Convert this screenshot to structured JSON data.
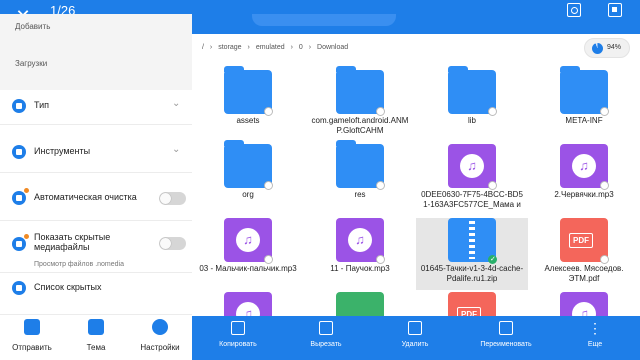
{
  "header": {
    "counter": "1/26",
    "close_icon": "close-icon",
    "accent": "#1e7ee8"
  },
  "drawer": {
    "top_items": [
      {
        "label": "Добавить"
      },
      {
        "label": "Загрузки"
      }
    ],
    "rows": [
      {
        "label": "Тип",
        "icon": "type-icon",
        "control": "chevron"
      },
      {
        "label": "Инструменты",
        "icon": "tools-icon",
        "control": "chevron"
      },
      {
        "label": "Автоматическая очистка",
        "icon": "clean-icon",
        "control": "toggle",
        "toggle_on": false
      },
      {
        "label": "Показать скрытые медиафайлы",
        "sublabel": "Просмотр файлов .nomedia",
        "icon": "hidden-media-icon",
        "control": "toggle",
        "toggle_on": false
      },
      {
        "label": "Список скрытых",
        "icon": "hidden-list-icon",
        "control": "none"
      }
    ],
    "bottom": [
      {
        "label": "Отправить",
        "icon": "gift-icon"
      },
      {
        "label": "Тема",
        "icon": "shirt-icon"
      },
      {
        "label": "Настройки",
        "icon": "gear-icon"
      }
    ]
  },
  "breadcrumb": [
    "/",
    "storage",
    "emulated",
    "0",
    "Download"
  ],
  "storage": {
    "percent_label": "94%",
    "used_fraction": 0.94
  },
  "files": [
    {
      "name": "assets",
      "type": "folder",
      "selected": false
    },
    {
      "name": "com.gameloft.android.ANM\nP.GloftCAHM",
      "type": "folder",
      "selected": false
    },
    {
      "name": "lib",
      "type": "folder",
      "selected": false
    },
    {
      "name": "META-INF",
      "type": "folder",
      "selected": false
    },
    {
      "name": "org",
      "type": "folder",
      "selected": false
    },
    {
      "name": "res",
      "type": "folder",
      "selected": false
    },
    {
      "name": "0DEE0630-7F75-4BCC-BD5\n1-163A3FC577CE_Мама и",
      "type": "audio",
      "selected": false
    },
    {
      "name": "2.Червячки.mp3",
      "type": "audio",
      "selected": false
    },
    {
      "name": "03 - Мальчик-пальчик.mp3",
      "type": "audio",
      "selected": false
    },
    {
      "name": "11 - Паучок.mp3",
      "type": "audio",
      "selected": false
    },
    {
      "name": "01645-Тачки-v1-3-4d-cache-\nPdalife.ru1.zip",
      "type": "zip",
      "selected": true
    },
    {
      "name": "Алексеев. Мясоедов.\nЭТМ.pdf",
      "type": "pdf",
      "selected": false
    },
    {
      "name": "",
      "type": "audio",
      "selected": false
    },
    {
      "name": "",
      "type": "green",
      "selected": false
    },
    {
      "name": "",
      "type": "pdf",
      "selected": false
    },
    {
      "name": "",
      "type": "audio",
      "selected": false
    }
  ],
  "toolbar": [
    {
      "label": "Копировать",
      "icon": "copy-icon"
    },
    {
      "label": "Вырезать",
      "icon": "cut-icon"
    },
    {
      "label": "Удалить",
      "icon": "delete-icon"
    },
    {
      "label": "Переименовать",
      "icon": "rename-icon"
    },
    {
      "label": "Еще",
      "icon": "more-icon"
    }
  ]
}
